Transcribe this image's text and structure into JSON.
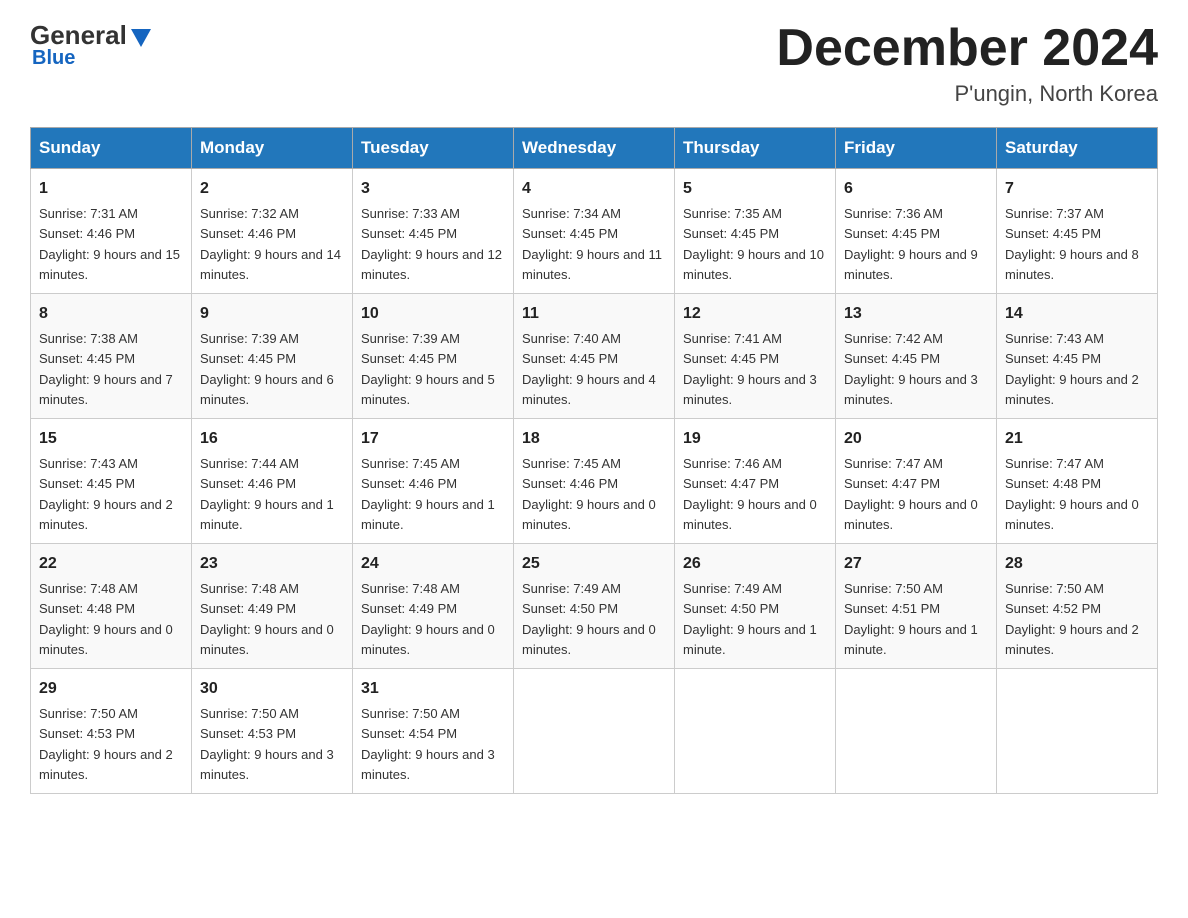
{
  "header": {
    "logo_general": "General",
    "logo_blue": "Blue",
    "month_title": "December 2024",
    "location": "P'ungin, North Korea"
  },
  "days_of_week": [
    "Sunday",
    "Monday",
    "Tuesday",
    "Wednesday",
    "Thursday",
    "Friday",
    "Saturday"
  ],
  "weeks": [
    [
      {
        "day": 1,
        "sunrise": "7:31 AM",
        "sunset": "4:46 PM",
        "daylight": "9 hours and 15 minutes."
      },
      {
        "day": 2,
        "sunrise": "7:32 AM",
        "sunset": "4:46 PM",
        "daylight": "9 hours and 14 minutes."
      },
      {
        "day": 3,
        "sunrise": "7:33 AM",
        "sunset": "4:45 PM",
        "daylight": "9 hours and 12 minutes."
      },
      {
        "day": 4,
        "sunrise": "7:34 AM",
        "sunset": "4:45 PM",
        "daylight": "9 hours and 11 minutes."
      },
      {
        "day": 5,
        "sunrise": "7:35 AM",
        "sunset": "4:45 PM",
        "daylight": "9 hours and 10 minutes."
      },
      {
        "day": 6,
        "sunrise": "7:36 AM",
        "sunset": "4:45 PM",
        "daylight": "9 hours and 9 minutes."
      },
      {
        "day": 7,
        "sunrise": "7:37 AM",
        "sunset": "4:45 PM",
        "daylight": "9 hours and 8 minutes."
      }
    ],
    [
      {
        "day": 8,
        "sunrise": "7:38 AM",
        "sunset": "4:45 PM",
        "daylight": "9 hours and 7 minutes."
      },
      {
        "day": 9,
        "sunrise": "7:39 AM",
        "sunset": "4:45 PM",
        "daylight": "9 hours and 6 minutes."
      },
      {
        "day": 10,
        "sunrise": "7:39 AM",
        "sunset": "4:45 PM",
        "daylight": "9 hours and 5 minutes."
      },
      {
        "day": 11,
        "sunrise": "7:40 AM",
        "sunset": "4:45 PM",
        "daylight": "9 hours and 4 minutes."
      },
      {
        "day": 12,
        "sunrise": "7:41 AM",
        "sunset": "4:45 PM",
        "daylight": "9 hours and 3 minutes."
      },
      {
        "day": 13,
        "sunrise": "7:42 AM",
        "sunset": "4:45 PM",
        "daylight": "9 hours and 3 minutes."
      },
      {
        "day": 14,
        "sunrise": "7:43 AM",
        "sunset": "4:45 PM",
        "daylight": "9 hours and 2 minutes."
      }
    ],
    [
      {
        "day": 15,
        "sunrise": "7:43 AM",
        "sunset": "4:45 PM",
        "daylight": "9 hours and 2 minutes."
      },
      {
        "day": 16,
        "sunrise": "7:44 AM",
        "sunset": "4:46 PM",
        "daylight": "9 hours and 1 minute."
      },
      {
        "day": 17,
        "sunrise": "7:45 AM",
        "sunset": "4:46 PM",
        "daylight": "9 hours and 1 minute."
      },
      {
        "day": 18,
        "sunrise": "7:45 AM",
        "sunset": "4:46 PM",
        "daylight": "9 hours and 0 minutes."
      },
      {
        "day": 19,
        "sunrise": "7:46 AM",
        "sunset": "4:47 PM",
        "daylight": "9 hours and 0 minutes."
      },
      {
        "day": 20,
        "sunrise": "7:47 AM",
        "sunset": "4:47 PM",
        "daylight": "9 hours and 0 minutes."
      },
      {
        "day": 21,
        "sunrise": "7:47 AM",
        "sunset": "4:48 PM",
        "daylight": "9 hours and 0 minutes."
      }
    ],
    [
      {
        "day": 22,
        "sunrise": "7:48 AM",
        "sunset": "4:48 PM",
        "daylight": "9 hours and 0 minutes."
      },
      {
        "day": 23,
        "sunrise": "7:48 AM",
        "sunset": "4:49 PM",
        "daylight": "9 hours and 0 minutes."
      },
      {
        "day": 24,
        "sunrise": "7:48 AM",
        "sunset": "4:49 PM",
        "daylight": "9 hours and 0 minutes."
      },
      {
        "day": 25,
        "sunrise": "7:49 AM",
        "sunset": "4:50 PM",
        "daylight": "9 hours and 0 minutes."
      },
      {
        "day": 26,
        "sunrise": "7:49 AM",
        "sunset": "4:50 PM",
        "daylight": "9 hours and 1 minute."
      },
      {
        "day": 27,
        "sunrise": "7:50 AM",
        "sunset": "4:51 PM",
        "daylight": "9 hours and 1 minute."
      },
      {
        "day": 28,
        "sunrise": "7:50 AM",
        "sunset": "4:52 PM",
        "daylight": "9 hours and 2 minutes."
      }
    ],
    [
      {
        "day": 29,
        "sunrise": "7:50 AM",
        "sunset": "4:53 PM",
        "daylight": "9 hours and 2 minutes."
      },
      {
        "day": 30,
        "sunrise": "7:50 AM",
        "sunset": "4:53 PM",
        "daylight": "9 hours and 3 minutes."
      },
      {
        "day": 31,
        "sunrise": "7:50 AM",
        "sunset": "4:54 PM",
        "daylight": "9 hours and 3 minutes."
      },
      null,
      null,
      null,
      null
    ]
  ]
}
